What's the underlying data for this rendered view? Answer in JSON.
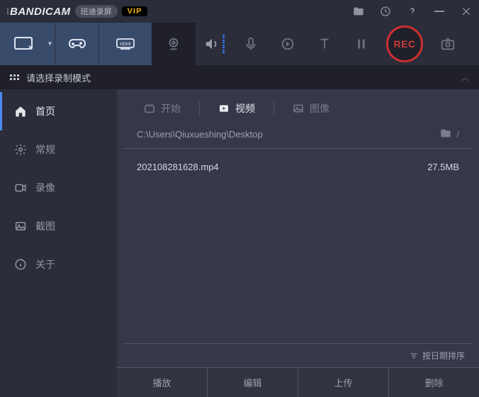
{
  "brand": {
    "name": "BANDICAM",
    "subtitle": "班迪录屏",
    "vip": "VIP"
  },
  "modebar": {
    "text": "请选择录制模式"
  },
  "rec": {
    "label": "REC"
  },
  "sidebar": {
    "items": [
      {
        "label": "首页"
      },
      {
        "label": "常规"
      },
      {
        "label": "录像"
      },
      {
        "label": "截图"
      },
      {
        "label": "关于"
      }
    ]
  },
  "subtabs": {
    "start": "开始",
    "video": "视频",
    "image": "图像"
  },
  "path": {
    "text": "C:\\Users\\Qiuxueshing\\Desktop",
    "suffix": "/"
  },
  "files": [
    {
      "name": "202108281628.mp4",
      "size": "27.5MB"
    }
  ],
  "sort": {
    "label": "按日期排序"
  },
  "actions": {
    "play": "播放",
    "edit": "编辑",
    "upload": "上传",
    "delete": "删除"
  }
}
